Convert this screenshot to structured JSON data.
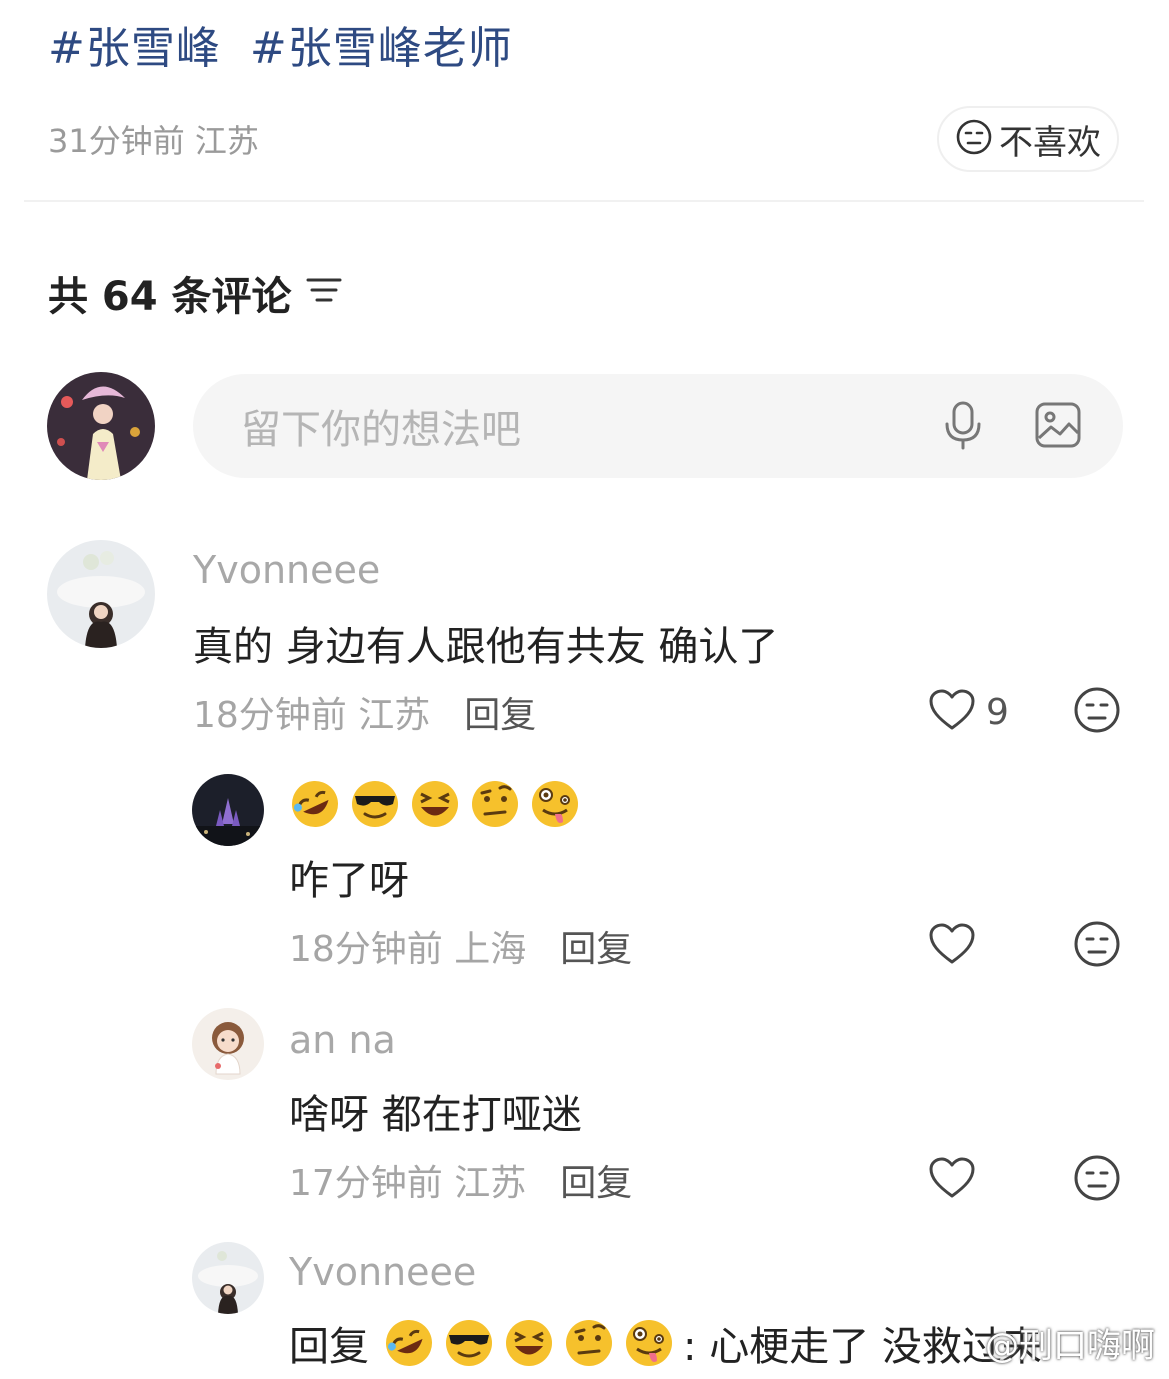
{
  "post": {
    "hashtags": [
      "#张雪峰",
      "#张雪峰老师"
    ],
    "meta": "31分钟前 江苏",
    "dislike_label": "不喜欢"
  },
  "comments_header": {
    "label": "共 64 条评论",
    "sort_icon": "filter-lines-icon"
  },
  "composer": {
    "placeholder": "留下你的想法吧",
    "icons": [
      "microphone-icon",
      "image-icon"
    ]
  },
  "comments": [
    {
      "username": "Yvonneee",
      "text": "真的 身边有人跟他有共友 确认了",
      "time_location": "18分钟前 江苏",
      "reply_label": "回复",
      "likes": "9"
    },
    {
      "username": "",
      "emoji_line": [
        "rofl",
        "sunglasses",
        "laughing",
        "raised-eyebrow",
        "zany"
      ],
      "text": "咋了呀",
      "time_location": "18分钟前 上海",
      "reply_label": "回复"
    },
    {
      "username": "an na",
      "text": "啥呀 都在打哑迷",
      "time_location": "17分钟前 江苏",
      "reply_label": "回复"
    },
    {
      "username": "Yvonneee",
      "reply_prefix": "回复",
      "emoji_line": [
        "rofl",
        "sunglasses",
        "laughing",
        "raised-eyebrow",
        "zany"
      ],
      "text": ": 心梗走了 没救过来"
    }
  ],
  "watermark": "@刑口嗨啊",
  "colors": {
    "hashtag": "#2e4a82",
    "meta_gray": "#a5a5a5",
    "input_bg": "#f5f5f5",
    "emoji_yellow": "#f6c12c"
  }
}
